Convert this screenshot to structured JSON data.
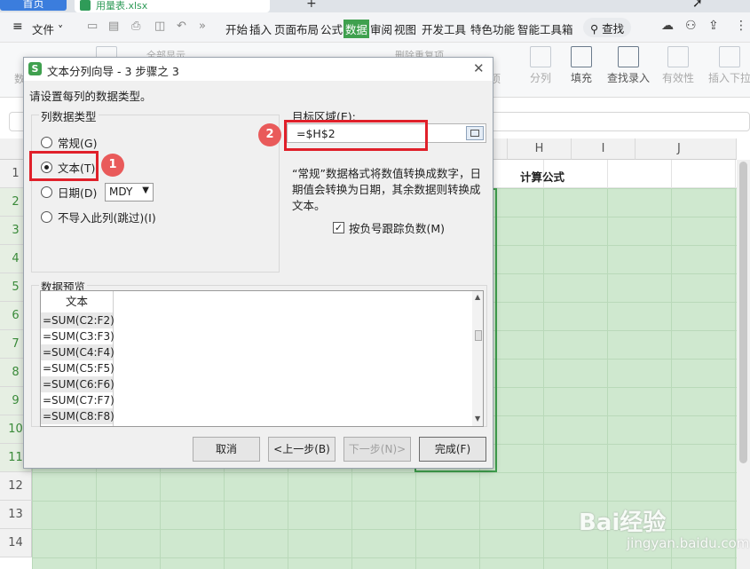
{
  "tabs": {
    "home": "首页",
    "file_name": "用量表.xlsx",
    "plus": "+"
  },
  "menubar": {
    "file_menu": "文件",
    "items": [
      "开始",
      "插入",
      "页面布局",
      "公式",
      "数据",
      "审阅",
      "视图",
      "开发工具",
      "特色功能",
      "智能工具箱"
    ],
    "active_item": "数据",
    "search": "查找"
  },
  "ribbon": {
    "left_items": [
      "全部显示",
      "删除重复项"
    ],
    "right_items": [
      {
        "label": "分列",
        "dim": true
      },
      {
        "label": "填充",
        "dim": false
      },
      {
        "label": "查找录入",
        "dim": false
      },
      {
        "label": "有效性",
        "dim": true
      },
      {
        "label": "插入下拉",
        "dim": true
      }
    ],
    "cut_labels": [
      "数",
      "项"
    ]
  },
  "sheet": {
    "columns": [
      "H",
      "I",
      "J"
    ],
    "rows": [
      "1",
      "2",
      "3",
      "4",
      "5",
      "6",
      "7",
      "8",
      "9",
      "10",
      "11",
      "12",
      "13",
      "14"
    ],
    "h1_value": "计算公式"
  },
  "dialog": {
    "title": "文本分列向导 - 3 步骤之 3",
    "prompt": "请设置每列的数据类型。",
    "column_type_caption": "列数据类型",
    "radios": [
      {
        "label": "常规(G)",
        "checked": false
      },
      {
        "label": "文本(T)",
        "checked": true
      },
      {
        "label": "日期(D)",
        "checked": false
      },
      {
        "label": "不导入此列(跳过)(I)",
        "checked": false
      }
    ],
    "date_format": "MDY",
    "target_label": "目标区域(E):",
    "target_value": "=$H$2",
    "description": "“常规”数据格式将数值转换成数字，日期值会转换为日期，其余数据则转换成文本。",
    "checkbox_label": "按负号跟踪负数(M)",
    "checkbox_checked": true,
    "preview_caption": "数据预览",
    "preview_header": "文本",
    "preview_rows": [
      "=SUM(C2:F2)",
      "=SUM(C3:F3)",
      "=SUM(C4:F4)",
      "=SUM(C5:F5)",
      "=SUM(C6:F6)",
      "=SUM(C7:F7)",
      "=SUM(C8:F8)"
    ],
    "buttons": {
      "cancel": "取消",
      "back": "<上一步(B)",
      "next": "下一步(N)>",
      "finish": "完成(F)"
    }
  },
  "annotations": {
    "badge_1": "1",
    "badge_2": "2"
  },
  "watermark": {
    "brand": "Bai经验",
    "url": "jingyan.baidu.com"
  }
}
